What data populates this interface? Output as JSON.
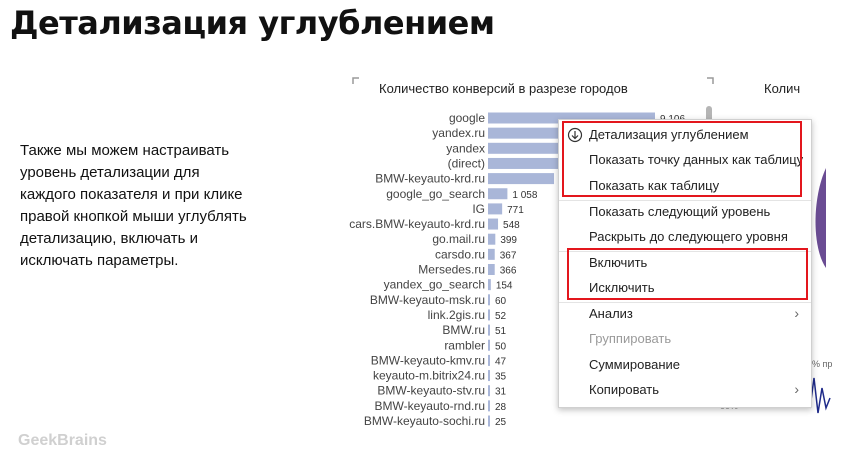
{
  "slide": {
    "title": "Детализация углублением",
    "body": "Также мы можем настраивать уровень детализации для каждого показателя и при клике правой кнопкой мыши углублять детализацию, включать и исключать параметры.",
    "logo": "GeekBrains"
  },
  "right_panel": {
    "title_fragment": "Колич",
    "label_fragment": "% пр",
    "label_fragment_2": "00%"
  },
  "chart_data": {
    "type": "bar",
    "orientation": "horizontal",
    "title": "Количество конверсий в разрезе городов",
    "categories": [
      "google",
      "yandex.ru",
      "yandex",
      "(direct)",
      "BMW-keyauto-krd.ru",
      "google_go_search",
      "IG",
      "cars.BMW-keyauto-krd.ru",
      "go.mail.ru",
      "carsdo.ru",
      "Mersedes.ru",
      "yandex_go_search",
      "BMW-keyauto-msk.ru",
      "link.2gis.ru",
      "BMW.ru",
      "rambler",
      "BMW-keyauto-kmv.ru",
      "keyauto-m.bitrix24.ru",
      "BMW-keyauto-stv.ru",
      "BMW-keyauto-rnd.ru",
      "BMW-keyauto-sochi.ru"
    ],
    "values": [
      9106,
      6800,
      5600,
      4700,
      3600,
      1058,
      771,
      548,
      399,
      367,
      366,
      154,
      60,
      52,
      51,
      50,
      47,
      35,
      31,
      28,
      25
    ],
    "data_labels": [
      "9 106",
      "",
      "",
      "",
      "",
      "1 058",
      "771",
      "548",
      "399",
      "367",
      "366",
      "154",
      "60",
      "52",
      "51",
      "50",
      "47",
      "35",
      "31",
      "28",
      "25"
    ],
    "bar_color": "#a9b6d8"
  },
  "context_menu": {
    "items": [
      {
        "label": "Детализация углублением",
        "icon": "drill-down-icon",
        "enabled": true,
        "submenu": false
      },
      {
        "label": "Показать точку данных как таблицу",
        "enabled": true,
        "submenu": false
      },
      {
        "label": "Показать как таблицу",
        "enabled": true,
        "submenu": false
      },
      {
        "label": "Показать следующий уровень",
        "enabled": true,
        "submenu": false
      },
      {
        "label": "Раскрыть до следующего уровня",
        "enabled": true,
        "submenu": false
      },
      {
        "label": "Включить",
        "enabled": true,
        "submenu": false
      },
      {
        "label": "Исключить",
        "enabled": true,
        "submenu": false
      },
      {
        "label": "Анализ",
        "enabled": true,
        "submenu": true
      },
      {
        "label": "Группировать",
        "enabled": false,
        "submenu": false
      },
      {
        "label": "Суммирование",
        "enabled": true,
        "submenu": false
      },
      {
        "label": "Копировать",
        "enabled": true,
        "submenu": true
      }
    ],
    "highlight_color": "#e3161d"
  }
}
